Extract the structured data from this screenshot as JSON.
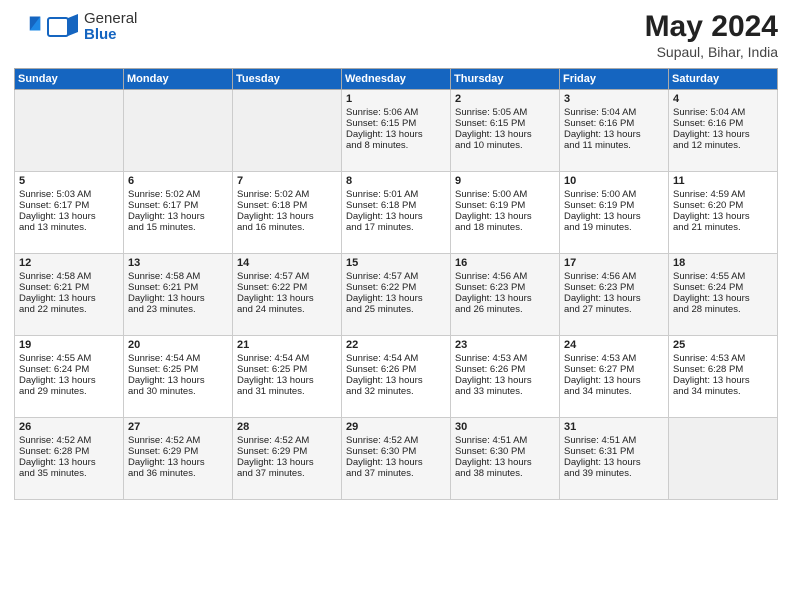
{
  "logo": {
    "general": "General",
    "blue": "Blue"
  },
  "title": "May 2024",
  "location": "Supaul, Bihar, India",
  "weekdays": [
    "Sunday",
    "Monday",
    "Tuesday",
    "Wednesday",
    "Thursday",
    "Friday",
    "Saturday"
  ],
  "weeks": [
    [
      {
        "day": "",
        "info": ""
      },
      {
        "day": "",
        "info": ""
      },
      {
        "day": "",
        "info": ""
      },
      {
        "day": "1",
        "info": "Sunrise: 5:06 AM\nSunset: 6:15 PM\nDaylight: 13 hours\nand 8 minutes."
      },
      {
        "day": "2",
        "info": "Sunrise: 5:05 AM\nSunset: 6:15 PM\nDaylight: 13 hours\nand 10 minutes."
      },
      {
        "day": "3",
        "info": "Sunrise: 5:04 AM\nSunset: 6:16 PM\nDaylight: 13 hours\nand 11 minutes."
      },
      {
        "day": "4",
        "info": "Sunrise: 5:04 AM\nSunset: 6:16 PM\nDaylight: 13 hours\nand 12 minutes."
      }
    ],
    [
      {
        "day": "5",
        "info": "Sunrise: 5:03 AM\nSunset: 6:17 PM\nDaylight: 13 hours\nand 13 minutes."
      },
      {
        "day": "6",
        "info": "Sunrise: 5:02 AM\nSunset: 6:17 PM\nDaylight: 13 hours\nand 15 minutes."
      },
      {
        "day": "7",
        "info": "Sunrise: 5:02 AM\nSunset: 6:18 PM\nDaylight: 13 hours\nand 16 minutes."
      },
      {
        "day": "8",
        "info": "Sunrise: 5:01 AM\nSunset: 6:18 PM\nDaylight: 13 hours\nand 17 minutes."
      },
      {
        "day": "9",
        "info": "Sunrise: 5:00 AM\nSunset: 6:19 PM\nDaylight: 13 hours\nand 18 minutes."
      },
      {
        "day": "10",
        "info": "Sunrise: 5:00 AM\nSunset: 6:19 PM\nDaylight: 13 hours\nand 19 minutes."
      },
      {
        "day": "11",
        "info": "Sunrise: 4:59 AM\nSunset: 6:20 PM\nDaylight: 13 hours\nand 21 minutes."
      }
    ],
    [
      {
        "day": "12",
        "info": "Sunrise: 4:58 AM\nSunset: 6:21 PM\nDaylight: 13 hours\nand 22 minutes."
      },
      {
        "day": "13",
        "info": "Sunrise: 4:58 AM\nSunset: 6:21 PM\nDaylight: 13 hours\nand 23 minutes."
      },
      {
        "day": "14",
        "info": "Sunrise: 4:57 AM\nSunset: 6:22 PM\nDaylight: 13 hours\nand 24 minutes."
      },
      {
        "day": "15",
        "info": "Sunrise: 4:57 AM\nSunset: 6:22 PM\nDaylight: 13 hours\nand 25 minutes."
      },
      {
        "day": "16",
        "info": "Sunrise: 4:56 AM\nSunset: 6:23 PM\nDaylight: 13 hours\nand 26 minutes."
      },
      {
        "day": "17",
        "info": "Sunrise: 4:56 AM\nSunset: 6:23 PM\nDaylight: 13 hours\nand 27 minutes."
      },
      {
        "day": "18",
        "info": "Sunrise: 4:55 AM\nSunset: 6:24 PM\nDaylight: 13 hours\nand 28 minutes."
      }
    ],
    [
      {
        "day": "19",
        "info": "Sunrise: 4:55 AM\nSunset: 6:24 PM\nDaylight: 13 hours\nand 29 minutes."
      },
      {
        "day": "20",
        "info": "Sunrise: 4:54 AM\nSunset: 6:25 PM\nDaylight: 13 hours\nand 30 minutes."
      },
      {
        "day": "21",
        "info": "Sunrise: 4:54 AM\nSunset: 6:25 PM\nDaylight: 13 hours\nand 31 minutes."
      },
      {
        "day": "22",
        "info": "Sunrise: 4:54 AM\nSunset: 6:26 PM\nDaylight: 13 hours\nand 32 minutes."
      },
      {
        "day": "23",
        "info": "Sunrise: 4:53 AM\nSunset: 6:26 PM\nDaylight: 13 hours\nand 33 minutes."
      },
      {
        "day": "24",
        "info": "Sunrise: 4:53 AM\nSunset: 6:27 PM\nDaylight: 13 hours\nand 34 minutes."
      },
      {
        "day": "25",
        "info": "Sunrise: 4:53 AM\nSunset: 6:28 PM\nDaylight: 13 hours\nand 34 minutes."
      }
    ],
    [
      {
        "day": "26",
        "info": "Sunrise: 4:52 AM\nSunset: 6:28 PM\nDaylight: 13 hours\nand 35 minutes."
      },
      {
        "day": "27",
        "info": "Sunrise: 4:52 AM\nSunset: 6:29 PM\nDaylight: 13 hours\nand 36 minutes."
      },
      {
        "day": "28",
        "info": "Sunrise: 4:52 AM\nSunset: 6:29 PM\nDaylight: 13 hours\nand 37 minutes."
      },
      {
        "day": "29",
        "info": "Sunrise: 4:52 AM\nSunset: 6:30 PM\nDaylight: 13 hours\nand 37 minutes."
      },
      {
        "day": "30",
        "info": "Sunrise: 4:51 AM\nSunset: 6:30 PM\nDaylight: 13 hours\nand 38 minutes."
      },
      {
        "day": "31",
        "info": "Sunrise: 4:51 AM\nSunset: 6:31 PM\nDaylight: 13 hours\nand 39 minutes."
      },
      {
        "day": "",
        "info": ""
      }
    ]
  ]
}
